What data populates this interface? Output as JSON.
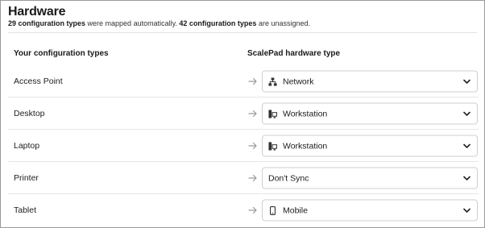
{
  "header": {
    "title": "Hardware",
    "mapped_count": "29 configuration types",
    "mapped_suffix": " were mapped automatically. ",
    "unassigned_count": "42 configuration types",
    "unassigned_suffix": " are unassigned."
  },
  "columns": {
    "left": "Your configuration types",
    "right": "ScalePad hardware type"
  },
  "rows": [
    {
      "label": "Access Point",
      "value": "Network",
      "icon": "network-icon"
    },
    {
      "label": "Desktop",
      "value": "Workstation",
      "icon": "workstation-icon"
    },
    {
      "label": "Laptop",
      "value": "Workstation",
      "icon": "workstation-icon"
    },
    {
      "label": "Printer",
      "value": "Don't Sync",
      "icon": ""
    },
    {
      "label": "Tablet",
      "value": "Mobile",
      "icon": "mobile-icon"
    }
  ]
}
